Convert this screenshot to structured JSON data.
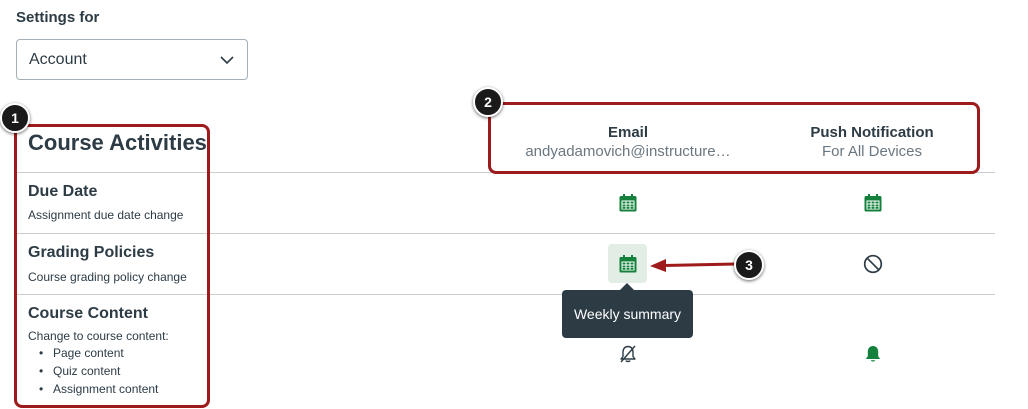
{
  "header": {
    "settings_for": "Settings for",
    "select_value": "Account"
  },
  "section": {
    "title": "Course Activities"
  },
  "columns": {
    "email": {
      "title": "Email",
      "subtitle": "andyadamovich@instructure…"
    },
    "push": {
      "title": "Push Notification",
      "subtitle": "For All Devices"
    }
  },
  "rows": [
    {
      "title": "Due Date",
      "description": "Assignment due date change",
      "email_icon": "calendar-icon",
      "push_icon": "calendar-icon"
    },
    {
      "title": "Grading Policies",
      "description": "Course grading policy change",
      "email_icon": "calendar-icon",
      "push_icon": "no-entry-icon"
    },
    {
      "title": "Course Content",
      "description": "Change to course content:",
      "list": [
        "Page content",
        "Quiz content",
        "Assignment content"
      ],
      "email_icon": "bell-off-icon",
      "push_icon": "bell-icon"
    }
  ],
  "tooltip": "Weekly summary",
  "annotations": [
    "1",
    "2",
    "3"
  ],
  "colors": {
    "text": "#2d3b45",
    "green": "#13813c",
    "annotation_red": "#9e1b1b",
    "tooltip_bg": "#2d3b45",
    "divider": "#c7cdd1"
  }
}
